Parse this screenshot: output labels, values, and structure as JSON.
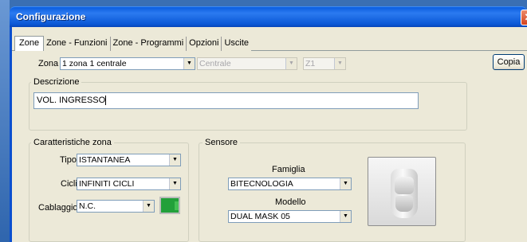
{
  "window": {
    "title": "Configurazione",
    "close_glyph": "✕"
  },
  "tabs": [
    {
      "label": "Zone",
      "active": true
    },
    {
      "label": "Zone - Funzioni"
    },
    {
      "label": "Zone - Programmi"
    },
    {
      "label": "Opzioni"
    },
    {
      "label": "Uscite"
    }
  ],
  "zone_row": {
    "label": "Zona",
    "zone_value": "1 zona 1 centrale",
    "centrale_value": "Centrale",
    "z_value": "Z1"
  },
  "copia_button": "Copia",
  "descrizione": {
    "group_label": "Descrizione",
    "value": "VOL. INGRESSO"
  },
  "caratteristiche": {
    "group_label": "Caratteristiche zona",
    "tipo_label": "Tipo",
    "tipo_value": "ISTANTANEA",
    "cicli_label": "Cicli",
    "cicli_value": "INFINITI CICLI",
    "cablaggio_label": "Cablaggio",
    "cablaggio_value": "N.C.",
    "status_color": "#22a03a"
  },
  "sensore": {
    "group_label": "Sensore",
    "famiglia_label": "Famiglia",
    "famiglia_value": "BITECNOLOGIA",
    "modello_label": "Modello",
    "modello_value": "DUAL MASK 05",
    "image": "sensor-device-image"
  },
  "icons": {
    "dropdown": "dropdown-arrow-icon",
    "close": "close-icon"
  }
}
